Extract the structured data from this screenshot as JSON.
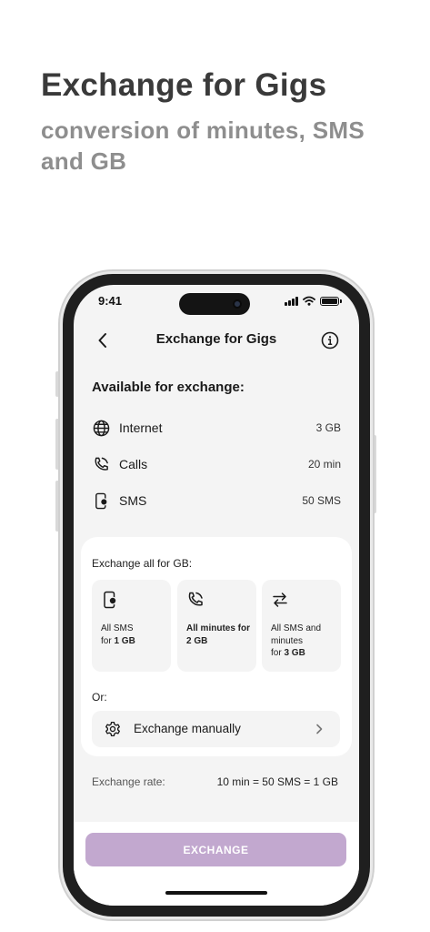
{
  "promo": {
    "headline": "Exchange for Gigs",
    "subline": "conversion of minutes, SMS and GB"
  },
  "status_bar": {
    "time": "9:41",
    "icons": [
      "signal-icon",
      "wifi-icon",
      "battery-icon"
    ]
  },
  "nav": {
    "title": "Exchange for Gigs",
    "back_icon": "chevron-left-icon",
    "info_icon": "info-icon"
  },
  "available": {
    "title": "Available for exchange:",
    "items": [
      {
        "icon": "globe-icon",
        "label": "Internet",
        "value": "3 GB"
      },
      {
        "icon": "phone-icon",
        "label": "Calls",
        "value": "20 min"
      },
      {
        "icon": "sms-icon",
        "label": "SMS",
        "value": "50 SMS"
      }
    ]
  },
  "exchange_all": {
    "title": "Exchange all for GB:",
    "options": [
      {
        "icon": "sms-icon",
        "line1": "All SMS",
        "prefix": "for ",
        "bold": "1 GB"
      },
      {
        "icon": "phone-icon",
        "line1": "",
        "prefix": "",
        "bold": "All minutes for 2 GB"
      },
      {
        "icon": "swap-icon",
        "line1": "All SMS and minutes",
        "prefix": "for ",
        "bold": "3 GB"
      }
    ]
  },
  "or_label": "Or:",
  "manual": {
    "label": "Exchange manually",
    "icon": "gear-icon",
    "chevron": "chevron-right-icon"
  },
  "rate": {
    "label": "Exchange rate:",
    "value": "10 min = 50 SMS = 1 GB"
  },
  "exchange_button": "EXCHANGE",
  "colors": {
    "button": "#c2a8cf",
    "screen_bg": "#f4f4f4"
  }
}
